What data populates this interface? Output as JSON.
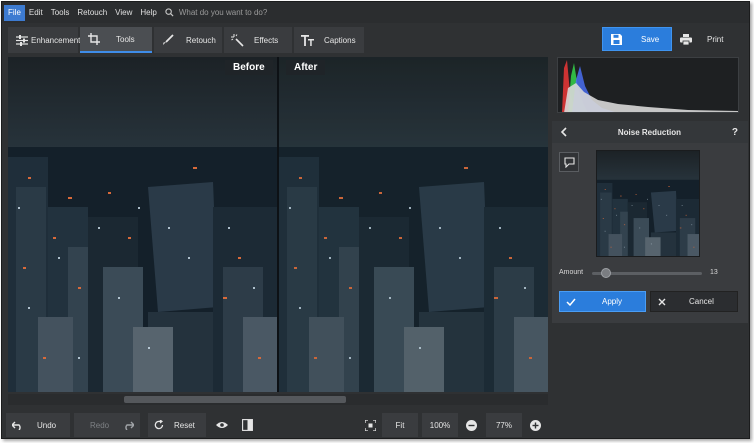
{
  "menu": {
    "items": [
      "File",
      "Edit",
      "Tools",
      "Retouch",
      "View",
      "Help"
    ],
    "search_placeholder": "What do you want to do?"
  },
  "toolbar": {
    "tabs": [
      {
        "label": "Enhancement",
        "icon": "sliders-icon"
      },
      {
        "label": "Tools",
        "icon": "crop-icon"
      },
      {
        "label": "Retouch",
        "icon": "brush-icon"
      },
      {
        "label": "Effects",
        "icon": "magic-wand-icon"
      },
      {
        "label": "Captions",
        "icon": "text-icon"
      }
    ],
    "active_tab": "Tools",
    "save_label": "Save",
    "print_label": "Print"
  },
  "preview": {
    "before_label": "Before",
    "after_label": "After"
  },
  "bottombar": {
    "undo_label": "Undo",
    "redo_label": "Redo",
    "reset_label": "Reset",
    "fit_label": "Fit",
    "zoom_preset": "100%",
    "zoom_value": "77%"
  },
  "panel": {
    "title": "Noise Reduction",
    "amount_label": "Amount",
    "amount_value": "13",
    "amount_fraction": 0.13,
    "apply_label": "Apply",
    "cancel_label": "Cancel",
    "help_label": "?"
  },
  "colors": {
    "accent": "#2b7ddc",
    "background": "#2f3133"
  }
}
